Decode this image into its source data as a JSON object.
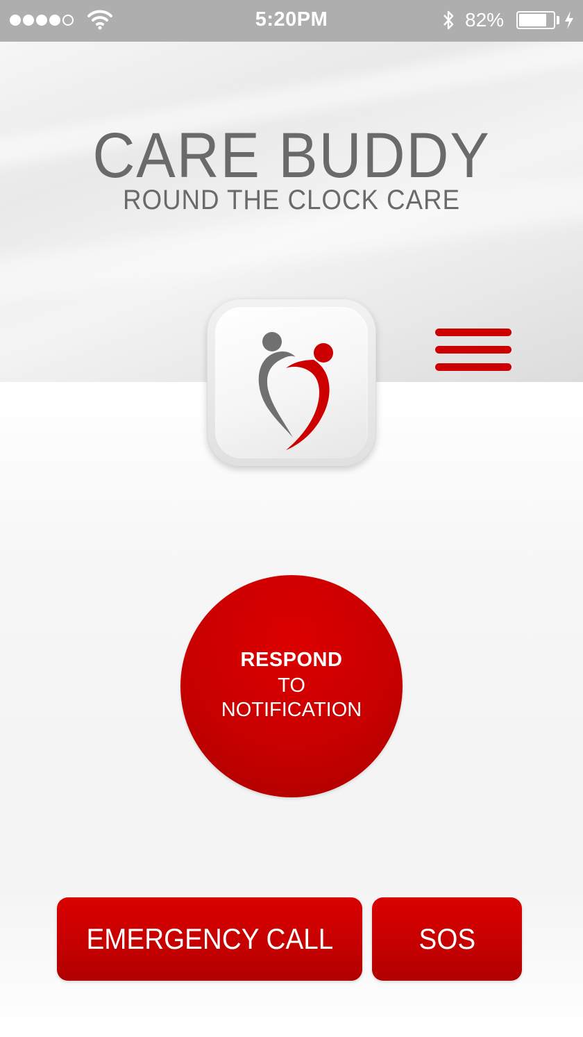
{
  "status_bar": {
    "time": "5:20PM",
    "battery_percent": "82%",
    "battery_level": 0.82,
    "signal_bars_filled": 4,
    "signal_bars_total": 5,
    "icons": [
      "signal-dots-icon",
      "wifi-icon",
      "bluetooth-icon",
      "battery-icon",
      "charging-bolt-icon"
    ]
  },
  "header": {
    "title": "CARE BUDDY",
    "subtitle": "ROUND THE CLOCK CARE",
    "menu_icon": "hamburger-menu-icon"
  },
  "logo": {
    "icon": "care-buddy-logo-icon",
    "colors": {
      "figure_left": "#707070",
      "figure_right": "#cc0000"
    }
  },
  "respond_button": {
    "line1": "RESPOND",
    "line2": "TO",
    "line3": "NOTIFICATION"
  },
  "actions": {
    "emergency_label": "EMERGENCY CALL",
    "sos_label": "SOS"
  },
  "colors": {
    "accent": "#cc0000",
    "status_bar_bg": "#aeaeae",
    "title_text": "#6a6a6a"
  }
}
